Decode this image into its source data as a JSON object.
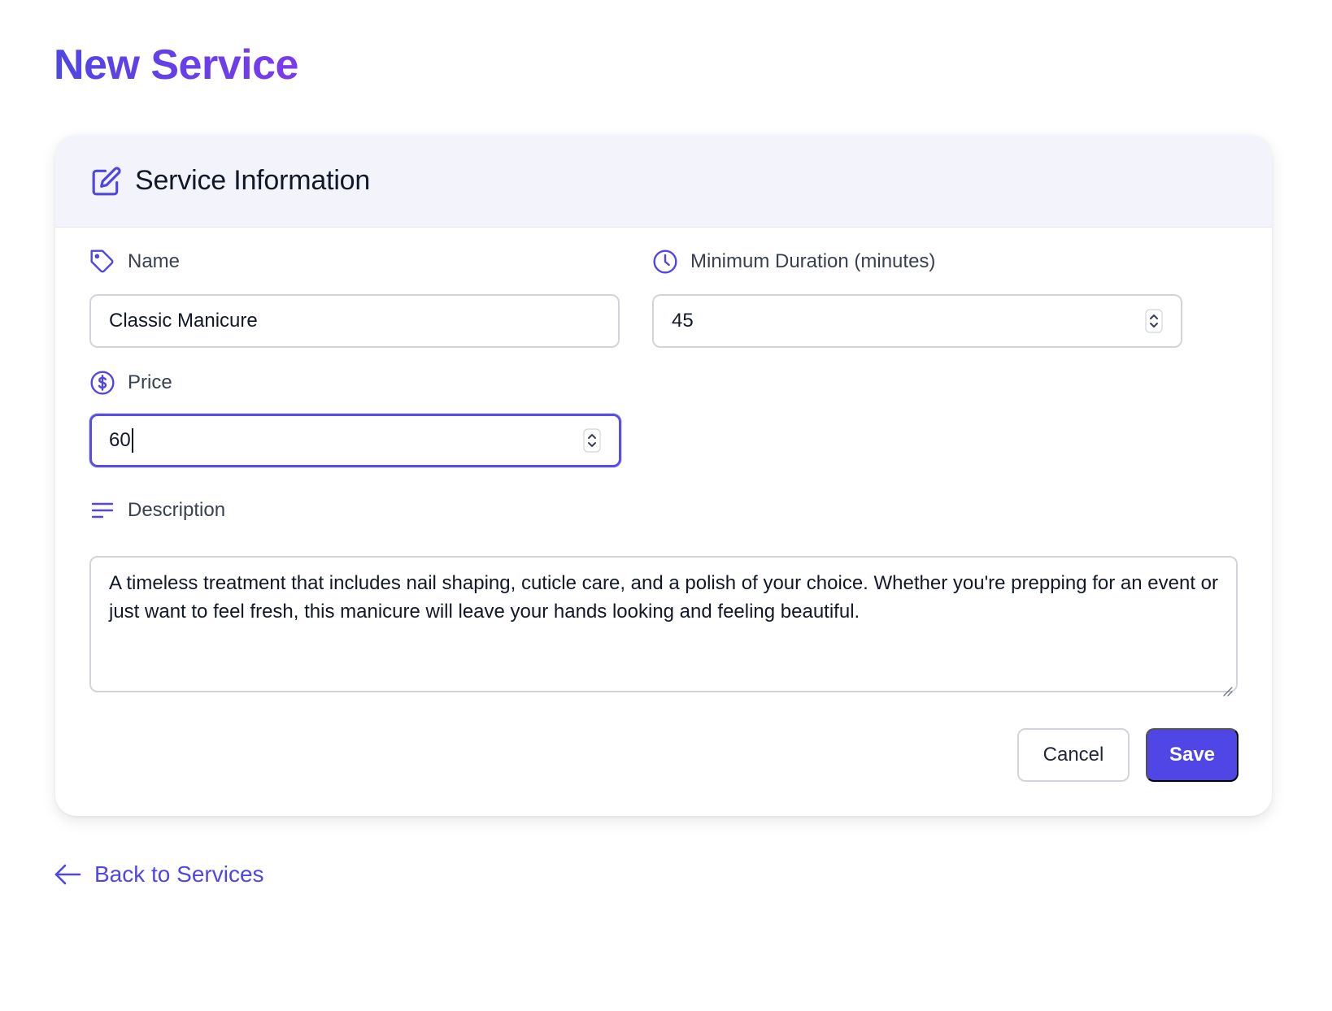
{
  "page": {
    "title": "New Service"
  },
  "card": {
    "title": "Service Information"
  },
  "form": {
    "name": {
      "label": "Name",
      "value": "Classic Manicure",
      "icon": "tag-icon"
    },
    "duration": {
      "label": "Minimum Duration (minutes)",
      "value": "45",
      "icon": "clock-icon"
    },
    "price": {
      "label": "Price",
      "value": "60",
      "icon": "dollar-circle-icon"
    },
    "description": {
      "label": "Description",
      "value": "A timeless treatment that includes nail shaping, cuticle care, and a polish of your choice. Whether you're prepping for an event or just want to feel fresh, this manicure will leave your hands looking and feeling beautiful.",
      "icon": "menu-lines-icon"
    }
  },
  "actions": {
    "cancel_label": "Cancel",
    "save_label": "Save"
  },
  "nav": {
    "back_label": "Back to Services",
    "back_icon": "arrow-left-icon"
  },
  "colors": {
    "accent": "#4f46e5",
    "accent_purple": "#7c3aed",
    "header_bg": "#f3f3fc"
  }
}
